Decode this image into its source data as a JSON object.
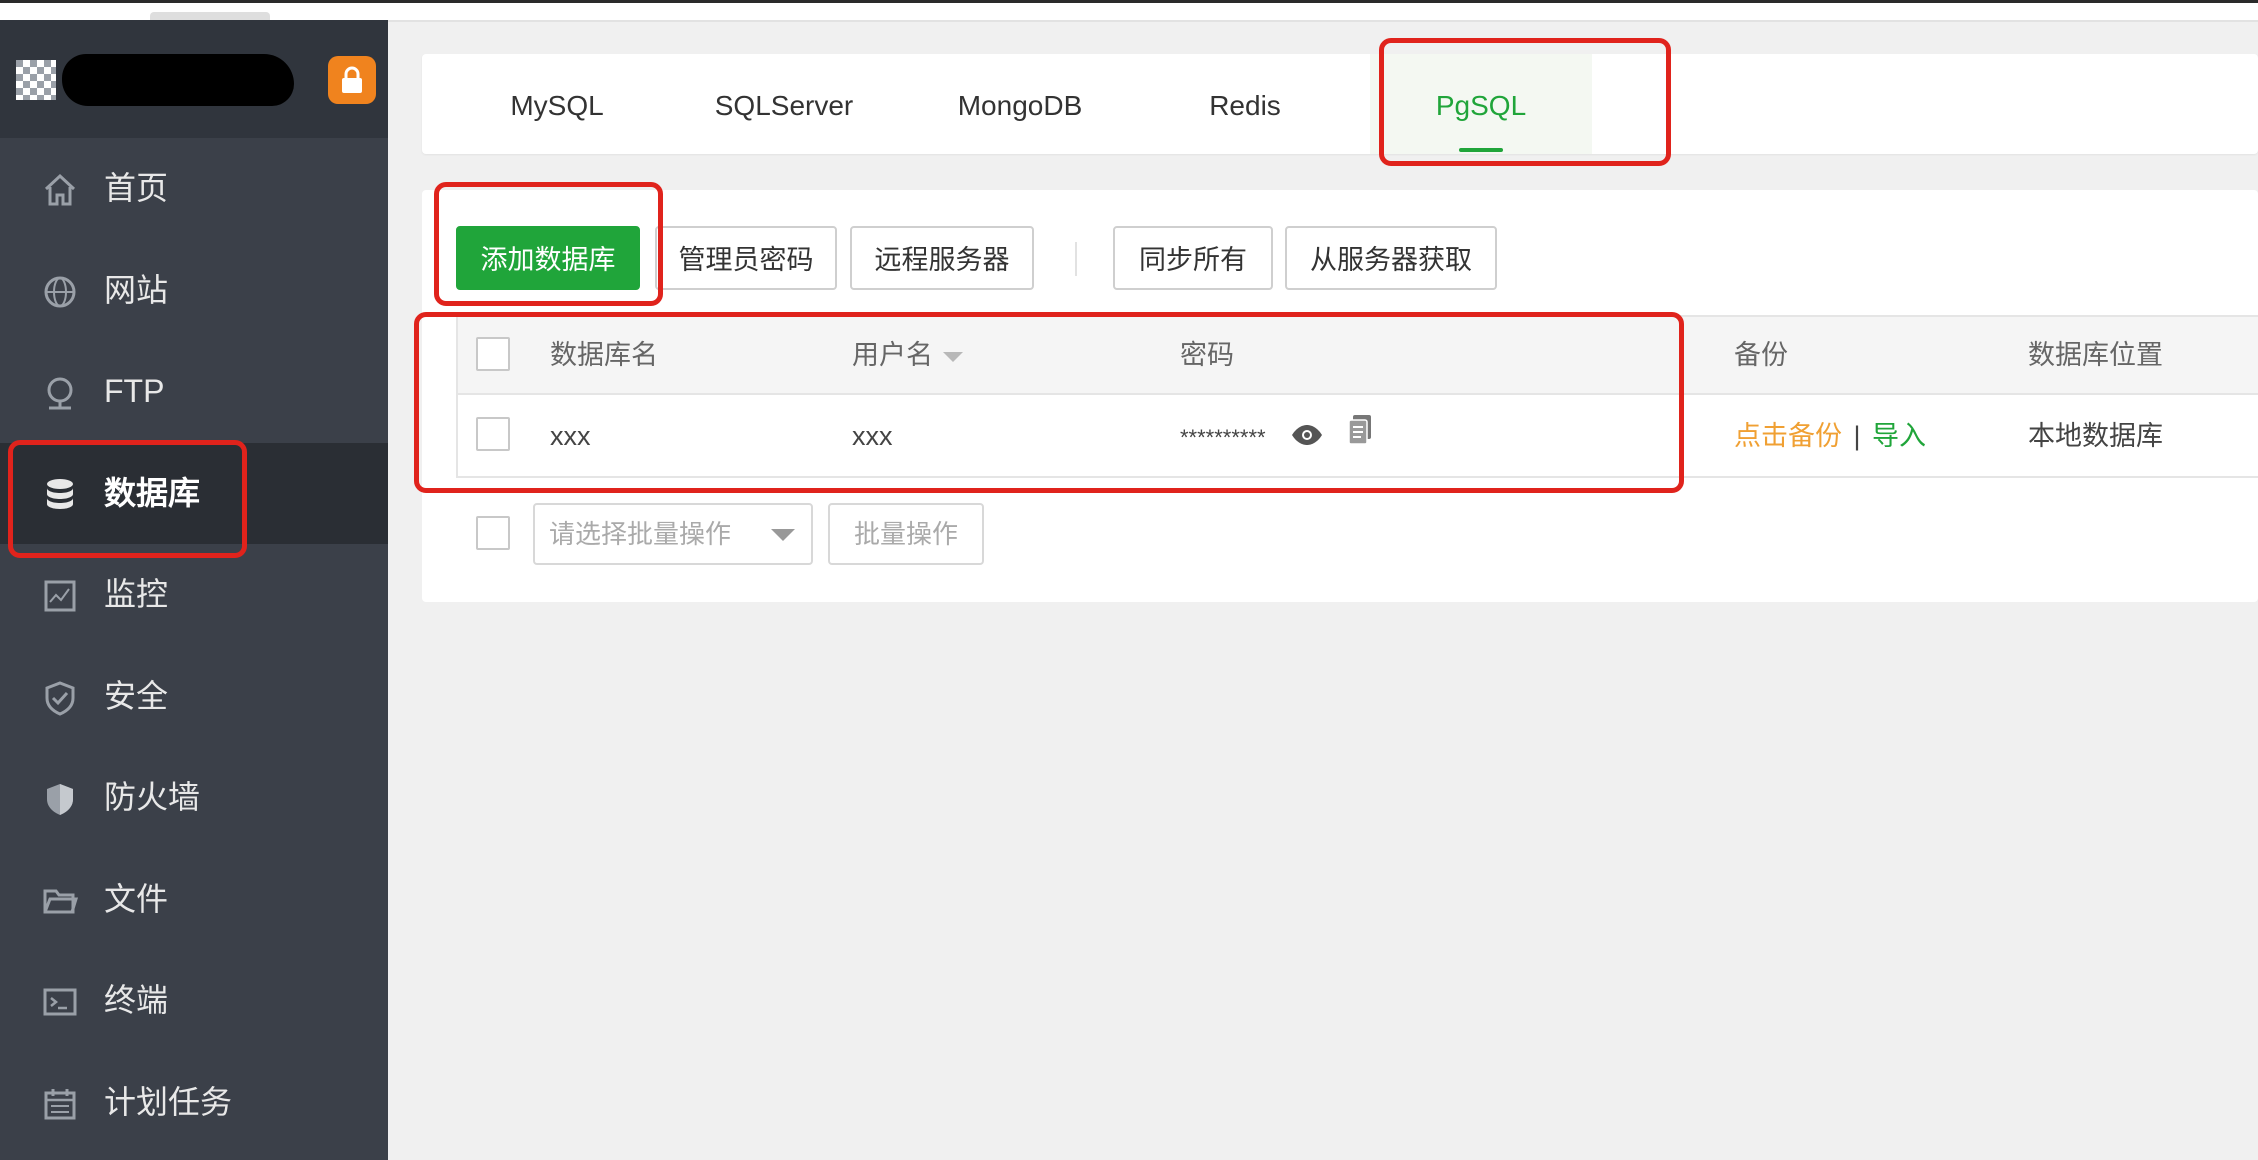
{
  "sidebar": {
    "items": [
      {
        "label": "首页",
        "icon": "home-icon"
      },
      {
        "label": "网站",
        "icon": "globe-icon"
      },
      {
        "label": "FTP",
        "icon": "ftp-icon"
      },
      {
        "label": "数据库",
        "icon": "database-icon"
      },
      {
        "label": "监控",
        "icon": "monitor-icon"
      },
      {
        "label": "安全",
        "icon": "shield-icon"
      },
      {
        "label": "防火墙",
        "icon": "firewall-icon"
      },
      {
        "label": "文件",
        "icon": "folder-icon"
      },
      {
        "label": "终端",
        "icon": "terminal-icon"
      },
      {
        "label": "计划任务",
        "icon": "calendar-icon"
      }
    ],
    "active": "数据库",
    "lock_icon": "lock-icon"
  },
  "db_tabs": [
    "MySQL",
    "SQLServer",
    "MongoDB",
    "Redis",
    "PgSQL"
  ],
  "active_tab": "PgSQL",
  "toolbar": {
    "add_db": "添加数据库",
    "admin_password": "管理员密码",
    "remote_server": "远程服务器",
    "sync_all": "同步所有",
    "fetch_from_server": "从服务器获取"
  },
  "table": {
    "headers": {
      "name": "数据库名",
      "username": "用户名",
      "password": "密码",
      "backup": "备份",
      "location": "数据库位置"
    },
    "rows": [
      {
        "name": "xxx",
        "username": "xxx",
        "password": "**********",
        "backup_action": "点击备份",
        "separator": "|",
        "import_action": "导入",
        "location": "本地数据库"
      }
    ]
  },
  "batch": {
    "placeholder": "请选择批量操作",
    "button": "批量操作"
  },
  "colors": {
    "accent": "#20a53a",
    "sidebar_bg": "#3b4049",
    "annotation": "#e0231c",
    "backup_link": "#f0a033"
  }
}
